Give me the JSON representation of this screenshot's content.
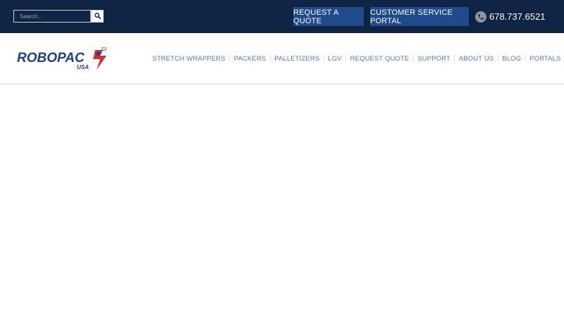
{
  "search": {
    "placeholder": "Search..."
  },
  "topbar": {
    "request_quote_label": "REQUEST A QUOTE",
    "customer_portal_label": "CUSTOMER SERVICE PORTAL",
    "phone_number": "678.737.6521"
  },
  "logo": {
    "brand": "ROBOPAC",
    "sub": "USA"
  },
  "nav": {
    "items": [
      {
        "label": "STRETCH WRAPPERS"
      },
      {
        "label": "PACKERS"
      },
      {
        "label": "PALLETIZERS"
      },
      {
        "label": "LGV"
      },
      {
        "label": "REQUEST QUOTE"
      },
      {
        "label": "SUPPORT"
      },
      {
        "label": "ABOUT US"
      },
      {
        "label": "BLOG"
      },
      {
        "label": "PORTALS"
      }
    ]
  },
  "colors": {
    "topbar_bg": "#0f2344",
    "cta_bg": "#1f4a8c",
    "nav_text": "#5a7bad",
    "logo_blue": "#1e3f8a",
    "logo_red": "#d82b2b"
  },
  "icons": {
    "search": "search-icon",
    "phone": "phone-icon"
  }
}
